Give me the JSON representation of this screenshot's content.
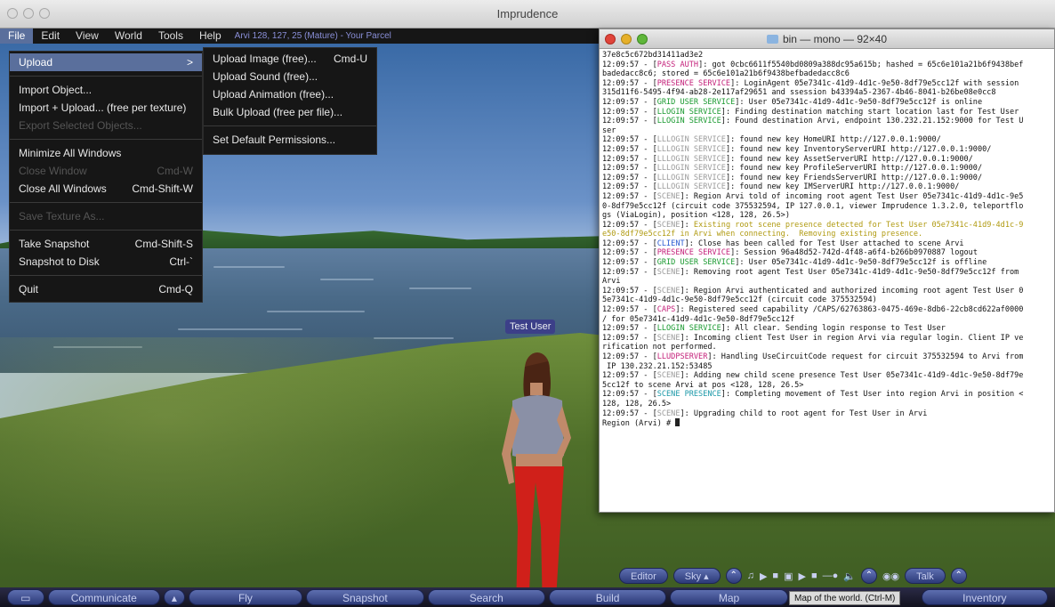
{
  "window": {
    "title": "Imprudence"
  },
  "menubar": {
    "items": [
      "File",
      "Edit",
      "View",
      "World",
      "Tools",
      "Help"
    ],
    "location": "Arvi 128, 127, 25 (Mature) - Your Parcel"
  },
  "file_menu": {
    "upload": "Upload",
    "upload_arrow": ">",
    "import_object": "Import Object...",
    "import_upload": "Import + Upload... (free per texture)",
    "export_selected": "Export Selected Objects...",
    "minimize_all": "Minimize All Windows",
    "close_window": "Close Window",
    "close_window_sc": "Cmd-W",
    "close_all": "Close All Windows",
    "close_all_sc": "Cmd-Shift-W",
    "save_texture": "Save Texture As...",
    "take_snapshot": "Take Snapshot",
    "take_snapshot_sc": "Cmd-Shift-S",
    "snapshot_disk": "Snapshot to Disk",
    "snapshot_disk_sc": "Ctrl-`",
    "quit": "Quit",
    "quit_sc": "Cmd-Q"
  },
  "upload_submenu": {
    "image": "Upload Image (free)...",
    "image_sc": "Cmd-U",
    "sound": "Upload Sound (free)...",
    "animation": "Upload Animation (free)...",
    "bulk": "Bulk Upload (free per file)...",
    "permissions": "Set Default Permissions..."
  },
  "avatar": {
    "name": "Test User"
  },
  "terminal": {
    "title": "bin — mono — 92×40",
    "lines": [
      [
        {
          "t": "37e8c5c672bd31411ad3e2"
        }
      ],
      [
        {
          "t": "12:09:57 - ["
        },
        {
          "t": "PASS AUTH",
          "c": "c-pink"
        },
        {
          "t": "]: got 0cbc6611f5540bd0809a388dc95a615b; hashed = 65c6e101a21b6f9438bef"
        }
      ],
      [
        {
          "t": "badedacc8c6; stored = 65c6e101a21b6f9438befbadedacc8c6"
        }
      ],
      [
        {
          "t": "12:09:57 - ["
        },
        {
          "t": "PRESENCE SERVICE",
          "c": "c-pink"
        },
        {
          "t": "]: LoginAgent 05e7341c-41d9-4d1c-9e50-8df79e5cc12f with session"
        }
      ],
      [
        {
          "t": "315d11f6-5495-4f94-ab28-2e117af29651 and ssession b43394a5-2367-4b46-8041-b26be08e0cc8"
        }
      ],
      [
        {
          "t": "12:09:57 - ["
        },
        {
          "t": "GRID USER SERVICE",
          "c": "c-green"
        },
        {
          "t": "]: User 05e7341c-41d9-4d1c-9e50-8df79e5cc12f is online"
        }
      ],
      [
        {
          "t": "12:09:57 - ["
        },
        {
          "t": "LLOGIN SERVICE",
          "c": "c-green"
        },
        {
          "t": "]: Finding destination matching start location last for Test User"
        }
      ],
      [
        {
          "t": "12:09:57 - ["
        },
        {
          "t": "LLOGIN SERVICE",
          "c": "c-green"
        },
        {
          "t": "]: Found destination Arvi, endpoint 130.232.21.152:9000 for Test U"
        }
      ],
      [
        {
          "t": "ser"
        }
      ],
      [
        {
          "t": "12:09:57 - ["
        },
        {
          "t": "LLLOGIN SERVICE",
          "c": "c-grey"
        },
        {
          "t": "]: found new key HomeURI http://127.0.0.1:9000/"
        }
      ],
      [
        {
          "t": "12:09:57 - ["
        },
        {
          "t": "LLLOGIN SERVICE",
          "c": "c-grey"
        },
        {
          "t": "]: found new key InventoryServerURI http://127.0.0.1:9000/"
        }
      ],
      [
        {
          "t": "12:09:57 - ["
        },
        {
          "t": "LLLOGIN SERVICE",
          "c": "c-grey"
        },
        {
          "t": "]: found new key AssetServerURI http://127.0.0.1:9000/"
        }
      ],
      [
        {
          "t": "12:09:57 - ["
        },
        {
          "t": "LLLOGIN SERVICE",
          "c": "c-grey"
        },
        {
          "t": "]: found new key ProfileServerURI http://127.0.0.1:9000/"
        }
      ],
      [
        {
          "t": "12:09:57 - ["
        },
        {
          "t": "LLLOGIN SERVICE",
          "c": "c-grey"
        },
        {
          "t": "]: found new key FriendsServerURI http://127.0.0.1:9000/"
        }
      ],
      [
        {
          "t": "12:09:57 - ["
        },
        {
          "t": "LLLOGIN SERVICE",
          "c": "c-grey"
        },
        {
          "t": "]: found new key IMServerURI http://127.0.0.1:9000/"
        }
      ],
      [
        {
          "t": "12:09:57 - ["
        },
        {
          "t": "SCENE",
          "c": "c-grey"
        },
        {
          "t": "]: Region Arvi told of incoming root agent Test User 05e7341c-41d9-4d1c-9e5"
        }
      ],
      [
        {
          "t": "0-8df79e5cc12f (circuit code 375532594, IP 127.0.0.1, viewer Imprudence 1.3.2.0, teleportflo"
        }
      ],
      [
        {
          "t": "gs (ViaLogin), position <128, 128, 26.5>)"
        }
      ],
      [
        {
          "t": "12:09:57 - ["
        },
        {
          "t": "SCENE",
          "c": "c-grey"
        },
        {
          "t": "]: "
        },
        {
          "t": "Existing root scene presence detected for Test User 05e7341c-41d9-4d1c-9",
          "c": "c-yellow"
        }
      ],
      [
        {
          "t": "e50-8df79e5cc12f in Arvi when connecting.  Removing existing presence.",
          "c": "c-yellow"
        }
      ],
      [
        {
          "t": "12:09:57 - ["
        },
        {
          "t": "CLIENT",
          "c": "c-blue"
        },
        {
          "t": "]: Close has been called for Test User attached to scene Arvi"
        }
      ],
      [
        {
          "t": "12:09:57 - ["
        },
        {
          "t": "PRESENCE SERVICE",
          "c": "c-pink"
        },
        {
          "t": "]: Session 96a48d52-742d-4f48-a6f4-b266b0970887 logout"
        }
      ],
      [
        {
          "t": "12:09:57 - ["
        },
        {
          "t": "GRID USER SERVICE",
          "c": "c-green"
        },
        {
          "t": "]: User 05e7341c-41d9-4d1c-9e50-8df79e5cc12f is offline"
        }
      ],
      [
        {
          "t": "12:09:57 - ["
        },
        {
          "t": "SCENE",
          "c": "c-grey"
        },
        {
          "t": "]: Removing root agent Test User 05e7341c-41d9-4d1c-9e50-8df79e5cc12f from"
        }
      ],
      [
        {
          "t": "Arvi"
        }
      ],
      [
        {
          "t": "12:09:57 - ["
        },
        {
          "t": "SCENE",
          "c": "c-grey"
        },
        {
          "t": "]: Region Arvi authenticated and authorized incoming root agent Test User 0"
        }
      ],
      [
        {
          "t": "5e7341c-41d9-4d1c-9e50-8df79e5cc12f (circuit code 375532594)"
        }
      ],
      [
        {
          "t": "12:09:57 - ["
        },
        {
          "t": "CAPS",
          "c": "c-pink"
        },
        {
          "t": "]: Registered seed capability /CAPS/62763863-0475-469e-8db6-22cb8cd622af0000"
        }
      ],
      [
        {
          "t": "/ for 05e7341c-41d9-4d1c-9e50-8df79e5cc12f"
        }
      ],
      [
        {
          "t": "12:09:57 - ["
        },
        {
          "t": "LLOGIN SERVICE",
          "c": "c-green"
        },
        {
          "t": "]: All clear. Sending login response to Test User"
        }
      ],
      [
        {
          "t": "12:09:57 - ["
        },
        {
          "t": "SCENE",
          "c": "c-grey"
        },
        {
          "t": "]: Incoming client Test User in region Arvi via regular login. Client IP ve"
        }
      ],
      [
        {
          "t": "rification not performed."
        }
      ],
      [
        {
          "t": "12:09:57 - ["
        },
        {
          "t": "LLUDPSERVER",
          "c": "c-pink"
        },
        {
          "t": "]: Handling UseCircuitCode request for circuit 375532594 to Arvi from"
        }
      ],
      [
        {
          "t": " IP 130.232.21.152:53485"
        }
      ],
      [
        {
          "t": "12:09:57 - ["
        },
        {
          "t": "SCENE",
          "c": "c-grey"
        },
        {
          "t": "]: Adding new child scene presence Test User 05e7341c-41d9-4d1c-9e50-8df79e"
        }
      ],
      [
        {
          "t": "5cc12f to scene Arvi at pos <128, 128, 26.5>"
        }
      ],
      [
        {
          "t": "12:09:57 - ["
        },
        {
          "t": "SCENE PRESENCE",
          "c": "c-cyan"
        },
        {
          "t": "]: Completing movement of Test User into region Arvi in position <"
        }
      ],
      [
        {
          "t": "128, 128, 26.5>"
        }
      ],
      [
        {
          "t": "12:09:57 - ["
        },
        {
          "t": "SCENE",
          "c": "c-grey"
        },
        {
          "t": "]: Upgrading child to root agent for Test User in Arvi"
        }
      ]
    ],
    "prompt": "Region (Arvi) # "
  },
  "mediabar": {
    "editor": "Editor",
    "sky": "Sky",
    "talk": "Talk"
  },
  "bottombar": {
    "communicate": "Communicate",
    "fly": "Fly",
    "snapshot": "Snapshot",
    "search": "Search",
    "build": "Build",
    "map": "Map",
    "inventory": "Inventory"
  },
  "tooltip": "Map of the world. (Ctrl-M)"
}
